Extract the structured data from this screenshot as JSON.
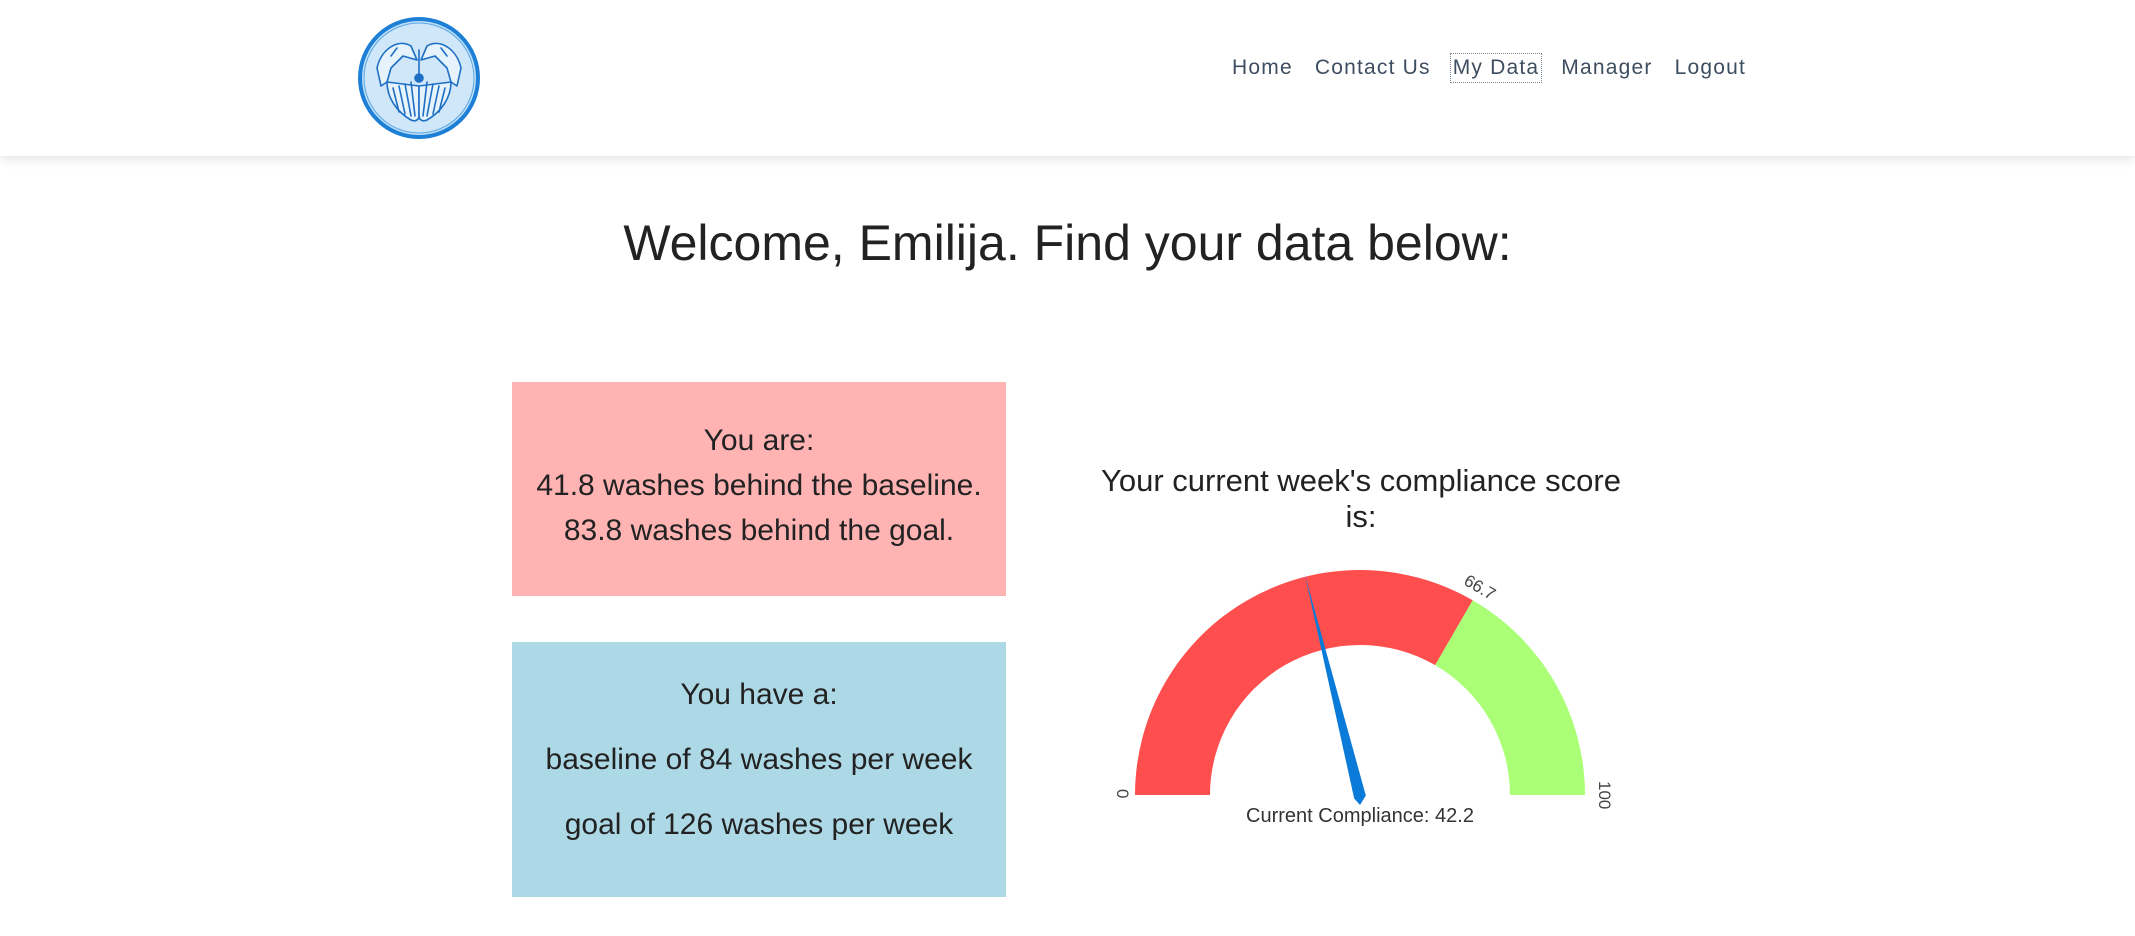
{
  "nav": {
    "items": [
      {
        "label": "Home",
        "active": false
      },
      {
        "label": "Contact Us",
        "active": false
      },
      {
        "label": "My Data",
        "active": true
      },
      {
        "label": "Manager",
        "active": false
      },
      {
        "label": "Logout",
        "active": false
      }
    ]
  },
  "logo": {
    "icon": "hands-logo-icon"
  },
  "page_title": "Welcome, Emilija. Find your data below:",
  "status_card": {
    "heading": "You are:",
    "line1": "41.8 washes behind the baseline.",
    "line2": "83.8 washes behind the goal.",
    "color": "#ffb3b3"
  },
  "targets_card": {
    "heading": "You have a:",
    "line1": "baseline of 84 washes per week",
    "line2": "goal of 126 washes per week",
    "color": "#add8e6"
  },
  "gauge": {
    "heading": "Your current week's compliance score is:",
    "min": 0,
    "max": 100,
    "threshold": 66.7,
    "value": 42.2,
    "min_label": "0",
    "max_label": "100",
    "threshold_label": "66.7",
    "value_label": "Current Compliance: 42.2",
    "colors": {
      "low": "#ff4e4e",
      "high": "#aaff77",
      "needle": "#0a7bd8"
    }
  }
}
